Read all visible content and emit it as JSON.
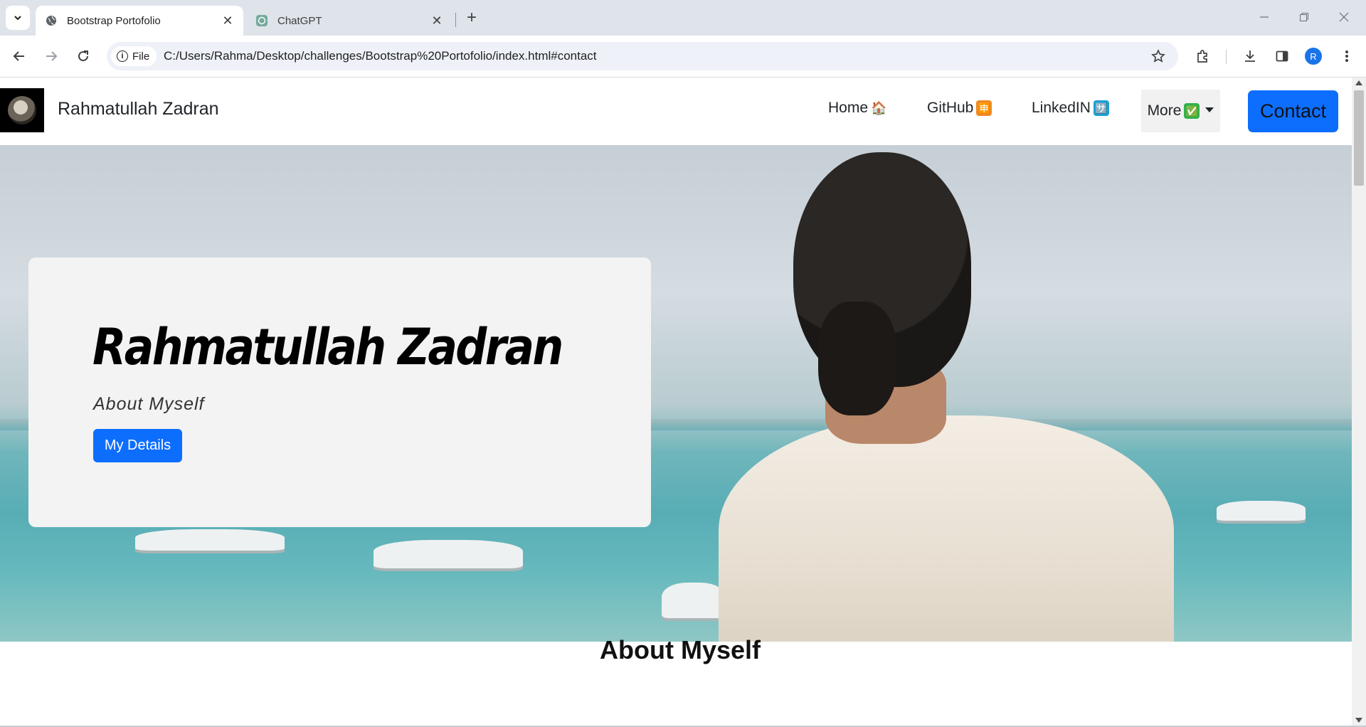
{
  "browser": {
    "tabs": [
      {
        "title": "Bootstrap Portofolio",
        "active": true
      },
      {
        "title": "ChatGPT",
        "active": false
      }
    ],
    "address": {
      "chip_label": "File",
      "url": "C:/Users/Rahma/Desktop/challenges/Bootstrap%20Portofolio/index.html#contact"
    },
    "profile_initial": "R"
  },
  "navbar": {
    "brand": "Rahmatullah Zadran",
    "links": [
      {
        "label": "Home",
        "emoji": "🏠"
      },
      {
        "label": "GitHub",
        "emoji": "🈸"
      },
      {
        "label": "LinkedIN",
        "emoji": "🈂️"
      }
    ],
    "more_label": "More",
    "more_emoji": "✅",
    "contact_label": "Contact"
  },
  "hero": {
    "title": "Rahmatullah Zadran",
    "subtitle": "About Myself",
    "button_label": "My Details"
  },
  "about": {
    "heading": "About Myself"
  },
  "colors": {
    "primary": "#0d6efd",
    "card_bg": "#f3f3f3",
    "chrome_bg": "#dfe3ea"
  }
}
